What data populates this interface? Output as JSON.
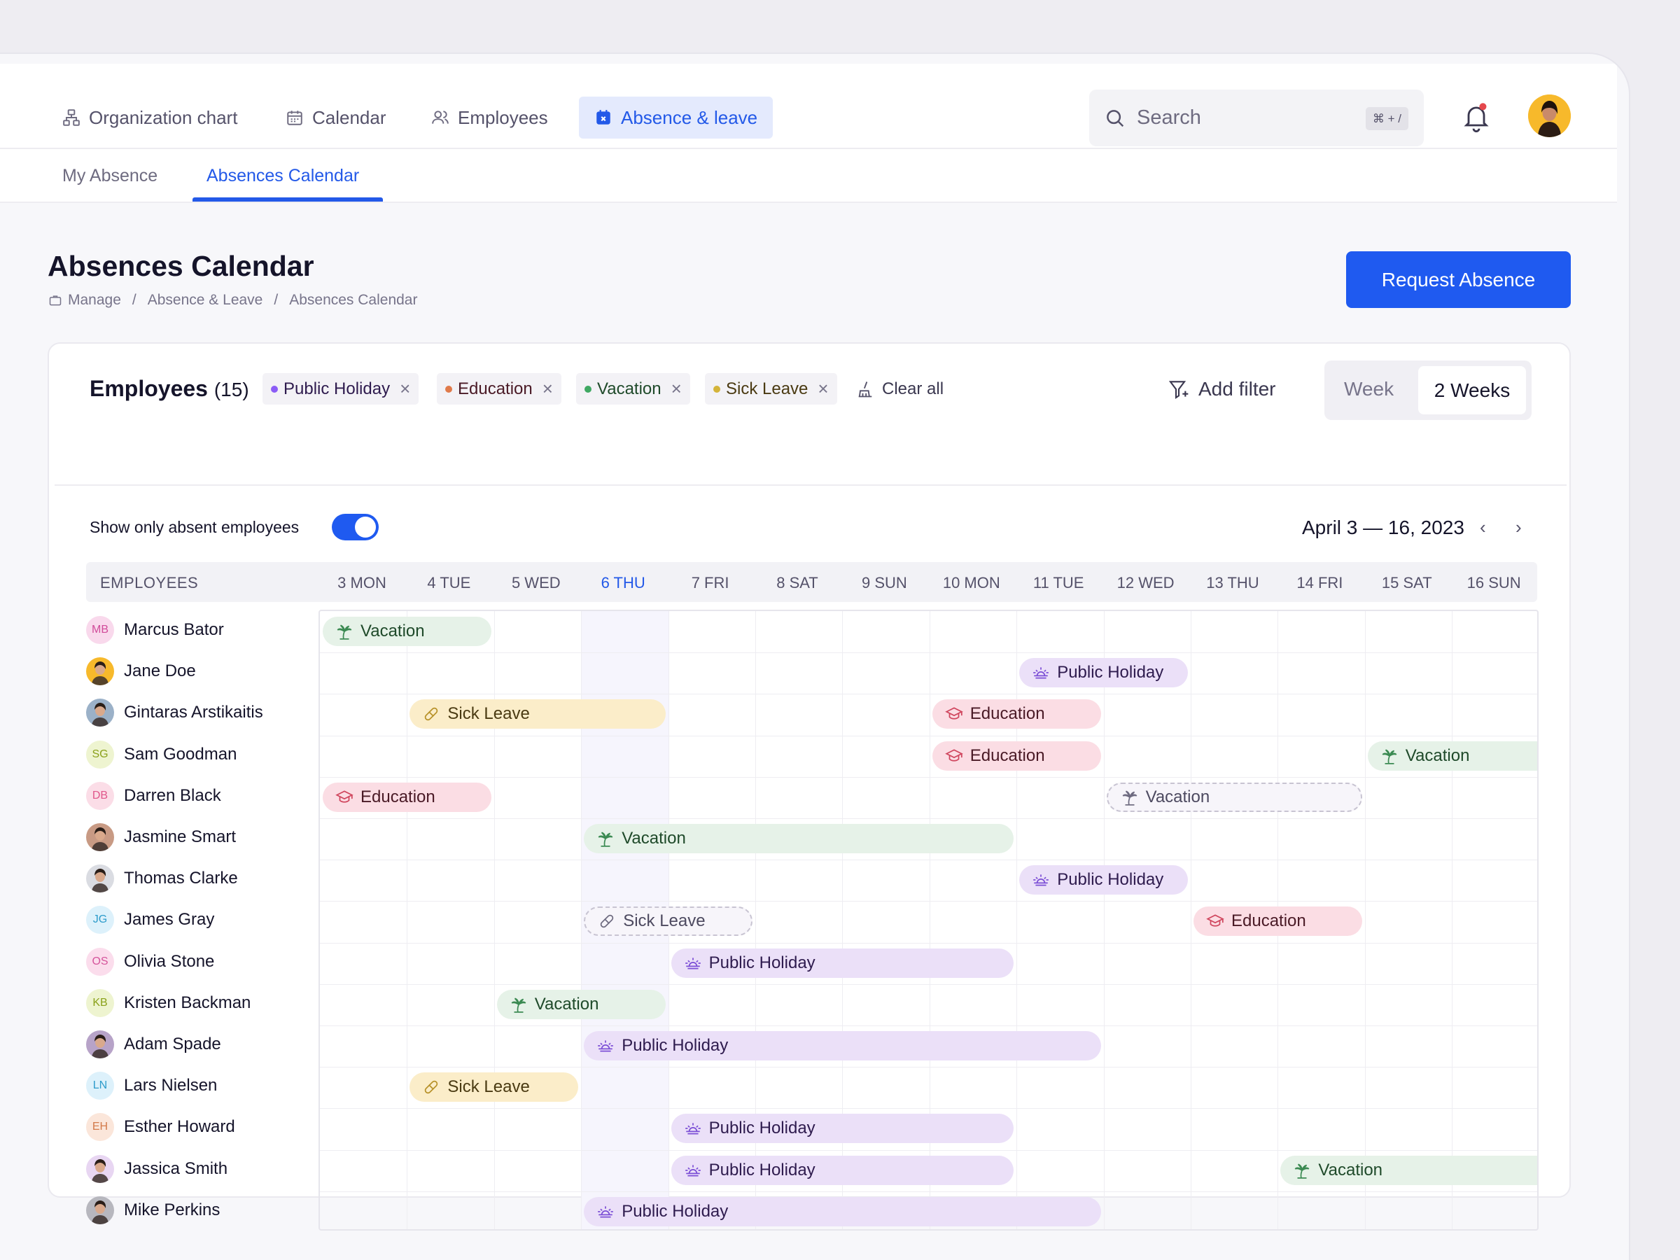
{
  "nav": {
    "items": [
      {
        "label": "Organization chart",
        "icon": "org-chart-icon"
      },
      {
        "label": "Calendar",
        "icon": "calendar-icon"
      },
      {
        "label": "Employees",
        "icon": "users-icon"
      },
      {
        "label": "Absence & leave",
        "icon": "calendar-x-icon",
        "active": true
      }
    ],
    "search_placeholder": "Search",
    "search_shortcut": "⌘ + /"
  },
  "subtabs": [
    {
      "label": "My Absence",
      "active": false
    },
    {
      "label": "Absences Calendar",
      "active": true
    }
  ],
  "page": {
    "title": "Absences Calendar",
    "breadcrumb": [
      "Manage",
      "Absence & Leave",
      "Absences Calendar"
    ],
    "request_button": "Request Absence"
  },
  "card": {
    "title": "Employees",
    "count": "(15)",
    "filters": [
      {
        "label": "Public Holiday",
        "color": "#8B5CF6"
      },
      {
        "label": "Education",
        "color": "#E07A4A"
      },
      {
        "label": "Vacation",
        "color": "#3FA862"
      },
      {
        "label": "Sick Leave",
        "color": "#D4B43A"
      }
    ],
    "clear_all": "Clear all",
    "add_filter": "Add filter",
    "view_options": [
      "Week",
      "2 Weeks"
    ],
    "active_view": "2 Weeks",
    "toggle_label": "Show only absent employees",
    "toggle_on": true,
    "date_range": "April 3 — 16, 2023",
    "prev": "‹",
    "next": "›"
  },
  "grid": {
    "employees_header": "EMPLOYEES",
    "days": [
      "3 MON",
      "4 TUE",
      "5 WED",
      "6 THU",
      "7 FRI",
      "8 SAT",
      "9 SUN",
      "10 MON",
      "11 TUE",
      "12 WED",
      "13 THU",
      "14 FRI",
      "15 SAT",
      "16 SUN"
    ],
    "today_index": 3,
    "colors": {
      "vacation": "#E6F2E8",
      "sick": "#FBEDC9",
      "education": "#FBDDE4",
      "holiday": "#EBE0F8",
      "accent": "#1F5AF0"
    },
    "employees": [
      {
        "name": "Marcus Bator",
        "initials": "MB",
        "avatar_color": "#F9D9EC",
        "initials_color": "#D14B9A"
      },
      {
        "name": "Jane Doe",
        "initials": "",
        "avatar_color": "#F7B92B",
        "initials_color": ""
      },
      {
        "name": "Gintaras Arstikaitis",
        "initials": "",
        "avatar_color": "#9BB1C8",
        "initials_color": ""
      },
      {
        "name": "Sam Goodman",
        "initials": "SG",
        "avatar_color": "#EEF4D0",
        "initials_color": "#8AA11A"
      },
      {
        "name": "Darren Black",
        "initials": "DB",
        "avatar_color": "#FBDDE7",
        "initials_color": "#E0568A"
      },
      {
        "name": "Jasmine Smart",
        "initials": "",
        "avatar_color": "#C89A84",
        "initials_color": ""
      },
      {
        "name": "Thomas Clarke",
        "initials": "",
        "avatar_color": "#DADCE2",
        "initials_color": ""
      },
      {
        "name": "James Gray",
        "initials": "JG",
        "avatar_color": "#DDF1FB",
        "initials_color": "#2E9CCB"
      },
      {
        "name": "Olivia Stone",
        "initials": "OS",
        "avatar_color": "#FBDDEC",
        "initials_color": "#D5549B"
      },
      {
        "name": "Kristen Backman",
        "initials": "KB",
        "avatar_color": "#EEF4D0",
        "initials_color": "#8AA11A"
      },
      {
        "name": "Adam Spade",
        "initials": "",
        "avatar_color": "#B7A3C8",
        "initials_color": ""
      },
      {
        "name": "Lars Nielsen",
        "initials": "LN",
        "avatar_color": "#DDF1FB",
        "initials_color": "#2E9CCB"
      },
      {
        "name": "Esther Howard",
        "initials": "EH",
        "avatar_color": "#FBE6DA",
        "initials_color": "#D37A4A"
      },
      {
        "name": "Jassica Smith",
        "initials": "",
        "avatar_color": "#E8D6F2",
        "initials_color": ""
      },
      {
        "name": "Mike Perkins",
        "initials": "",
        "avatar_color": "#B7B7BE",
        "initials_color": ""
      }
    ],
    "absences": [
      {
        "row": 0,
        "start": 0,
        "days": 2,
        "type": "vac",
        "label": "Vacation",
        "icon": "palm-tree-icon"
      },
      {
        "row": 1,
        "start": 8,
        "days": 2,
        "type": "ph",
        "label": "Public Holiday",
        "icon": "sun-icon"
      },
      {
        "row": 2,
        "start": 1,
        "days": 3,
        "type": "sick",
        "label": "Sick Leave",
        "icon": "pill-icon"
      },
      {
        "row": 2,
        "start": 7,
        "days": 2,
        "type": "edu",
        "label": "Education",
        "icon": "graduation-cap-icon"
      },
      {
        "row": 3,
        "start": 7,
        "days": 2,
        "type": "edu",
        "label": "Education",
        "icon": "graduation-cap-icon"
      },
      {
        "row": 3,
        "start": 12,
        "days": 2,
        "type": "vac",
        "label": "Vacation",
        "icon": "palm-tree-icon"
      },
      {
        "row": 4,
        "start": 0,
        "days": 2,
        "type": "edu",
        "label": "Education",
        "icon": "graduation-cap-icon"
      },
      {
        "row": 4,
        "start": 9,
        "days": 3,
        "type": "dash",
        "label": "Vacation",
        "icon": "palm-tree-icon"
      },
      {
        "row": 5,
        "start": 3,
        "days": 5,
        "type": "vac",
        "label": "Vacation",
        "icon": "palm-tree-icon"
      },
      {
        "row": 6,
        "start": 8,
        "days": 2,
        "type": "ph",
        "label": "Public Holiday",
        "icon": "sun-icon"
      },
      {
        "row": 7,
        "start": 3,
        "days": 2,
        "type": "dash",
        "label": "Sick Leave",
        "icon": "pill-icon"
      },
      {
        "row": 7,
        "start": 10,
        "days": 2,
        "type": "edu",
        "label": "Education",
        "icon": "graduation-cap-icon"
      },
      {
        "row": 8,
        "start": 4,
        "days": 4,
        "type": "ph",
        "label": "Public Holiday",
        "icon": "sun-icon"
      },
      {
        "row": 9,
        "start": 2,
        "days": 2,
        "type": "vac",
        "label": "Vacation",
        "icon": "palm-tree-icon"
      },
      {
        "row": 10,
        "start": 3,
        "days": 6,
        "type": "ph",
        "label": "Public Holiday",
        "icon": "sun-icon"
      },
      {
        "row": 11,
        "start": 1,
        "days": 2,
        "type": "sick",
        "label": "Sick Leave",
        "icon": "pill-icon"
      },
      {
        "row": 12,
        "start": 4,
        "days": 4,
        "type": "ph",
        "label": "Public Holiday",
        "icon": "sun-icon"
      },
      {
        "row": 13,
        "start": 4,
        "days": 4,
        "type": "ph",
        "label": "Public Holiday",
        "icon": "sun-icon"
      },
      {
        "row": 13,
        "start": 11,
        "days": 3,
        "type": "vac",
        "label": "Vacation",
        "icon": "palm-tree-icon"
      },
      {
        "row": 14,
        "start": 3,
        "days": 6,
        "type": "ph",
        "label": "Public Holiday",
        "icon": "sun-icon"
      }
    ]
  }
}
